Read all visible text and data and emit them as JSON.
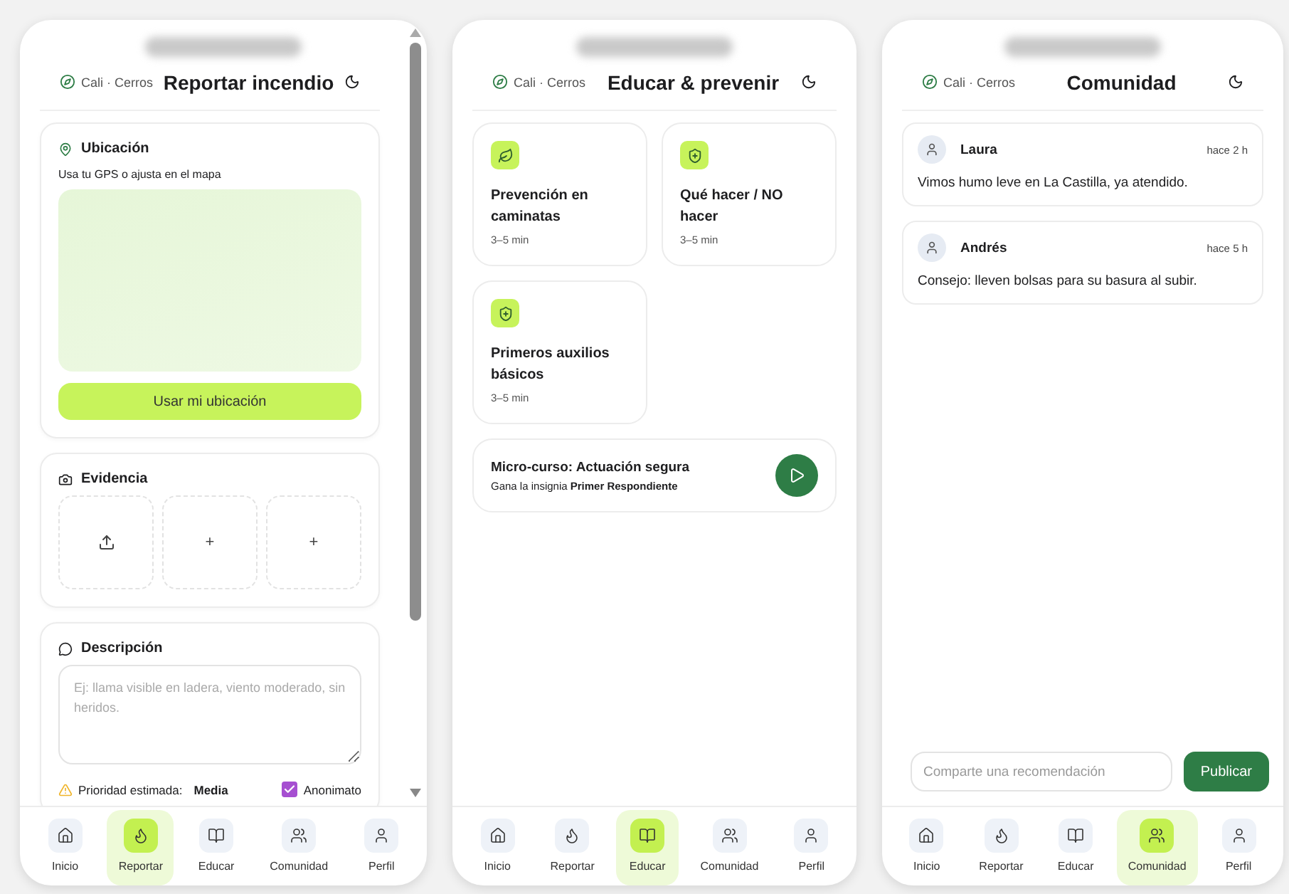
{
  "screens": [
    {
      "kind": "report",
      "location": "Cali · Cerros",
      "title": "Reportar incendio",
      "location_card": {
        "title": "Ubicación",
        "hint": "Usa tu GPS o ajusta en el mapa",
        "button": "Usar mi ubicación"
      },
      "evidence": {
        "title": "Evidencia",
        "slots": [
          {
            "kind": "upload"
          },
          {
            "kind": "add",
            "label": "+"
          },
          {
            "kind": "add",
            "label": "+"
          }
        ]
      },
      "description": {
        "title": "Descripción",
        "placeholder": "Ej: llama visible en ladera, viento moderado, sin heridos.",
        "priority_label": "Prioridad estimada:",
        "priority": "Media",
        "anonymous": {
          "label": "Anonimato",
          "checked": true
        }
      },
      "nav": [
        {
          "label": "Inicio",
          "selected": false
        },
        {
          "label": "Reportar",
          "selected": true
        },
        {
          "label": "Educar",
          "selected": false
        },
        {
          "label": "Comunidad",
          "selected": false
        },
        {
          "label": "Perfil",
          "selected": false
        }
      ]
    },
    {
      "kind": "educate",
      "location": "Cali · Cerros",
      "title": "Educar & prevenir",
      "lessons": [
        {
          "kind": "leaf",
          "title": "Prevención en caminatas",
          "duration": "3–5 min"
        },
        {
          "kind": "shield",
          "title": "Qué hacer / NO hacer",
          "duration": "3–5 min"
        },
        {
          "kind": "shield",
          "title": "Primeros auxilios básicos",
          "duration": "3–5 min"
        }
      ],
      "course": {
        "title": "Micro-curso: Actuación segura",
        "subtitle": "Gana la insignia **Primer Respondiente**"
      },
      "nav": [
        {
          "label": "Inicio",
          "selected": false
        },
        {
          "label": "Reportar",
          "selected": false
        },
        {
          "label": "Educar",
          "selected": true
        },
        {
          "label": "Comunidad",
          "selected": false
        },
        {
          "label": "Perfil",
          "selected": false
        }
      ]
    },
    {
      "kind": "community",
      "location": "Cali · Cerros",
      "title": "Comunidad",
      "posts": [
        {
          "author": "Laura",
          "time": "hace 2 h",
          "text": "Vimos humo leve en La Castilla, ya atendido."
        },
        {
          "author": "Andrés",
          "time": "hace 5 h",
          "text": "Consejo: lleven bolsas para su basura al subir."
        }
      ],
      "composer": {
        "placeholder": "Comparte una recomendación",
        "button": "Publicar"
      },
      "nav": [
        {
          "label": "Inicio",
          "selected": false
        },
        {
          "label": "Reportar",
          "selected": false
        },
        {
          "label": "Educar",
          "selected": false
        },
        {
          "label": "Comunidad",
          "selected": true
        },
        {
          "label": "Perfil",
          "selected": false
        }
      ]
    }
  ]
}
